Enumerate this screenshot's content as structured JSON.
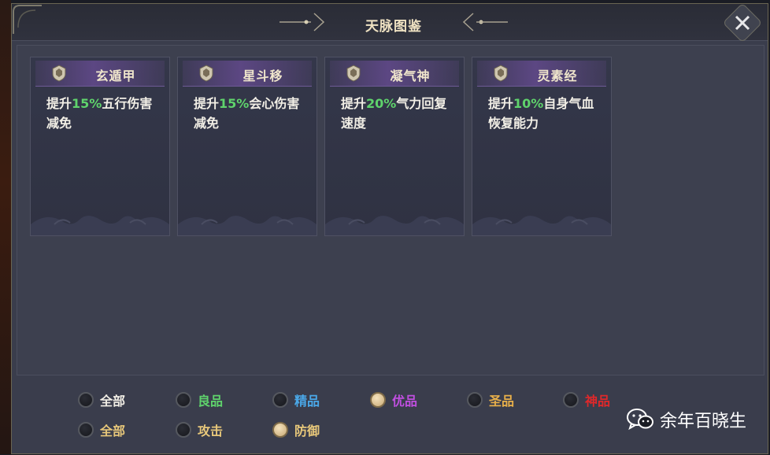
{
  "window": {
    "title": "天脉图鉴"
  },
  "cards": [
    {
      "name": "玄遁甲",
      "desc_pre": "提升",
      "highlight": "15%",
      "desc_post": "五行伤害减免"
    },
    {
      "name": "星斗移",
      "desc_pre": "提升",
      "highlight": "15%",
      "desc_post": "会心伤害减免"
    },
    {
      "name": "凝气神",
      "desc_pre": "提升",
      "highlight": "20%",
      "desc_post": "气力回复速度"
    },
    {
      "name": "灵素经",
      "desc_pre": "提升",
      "highlight": "10%",
      "desc_post": "自身气血恢复能力"
    }
  ],
  "filters": {
    "quality": [
      {
        "label": "全部",
        "color": "#f2efe6",
        "selected": false
      },
      {
        "label": "良品",
        "color": "#5fd36c",
        "selected": false
      },
      {
        "label": "精品",
        "color": "#4aa8e8",
        "selected": false
      },
      {
        "label": "优品",
        "color": "#c04fe0",
        "selected": true
      },
      {
        "label": "圣品",
        "color": "#e8b04a",
        "selected": false
      },
      {
        "label": "神品",
        "color": "#e0282a",
        "selected": false
      }
    ],
    "type": [
      {
        "label": "全部",
        "color": "#e8c87a",
        "selected": false
      },
      {
        "label": "攻击",
        "color": "#e8c87a",
        "selected": false
      },
      {
        "label": "防御",
        "color": "#e8c87a",
        "selected": true
      }
    ]
  },
  "watermark": {
    "text": "余年百晓生",
    "icon": "wechat-icon"
  },
  "colors": {
    "highlight": "#5fd36c",
    "card_header": "#5c4783",
    "panel": "#3d404f"
  }
}
